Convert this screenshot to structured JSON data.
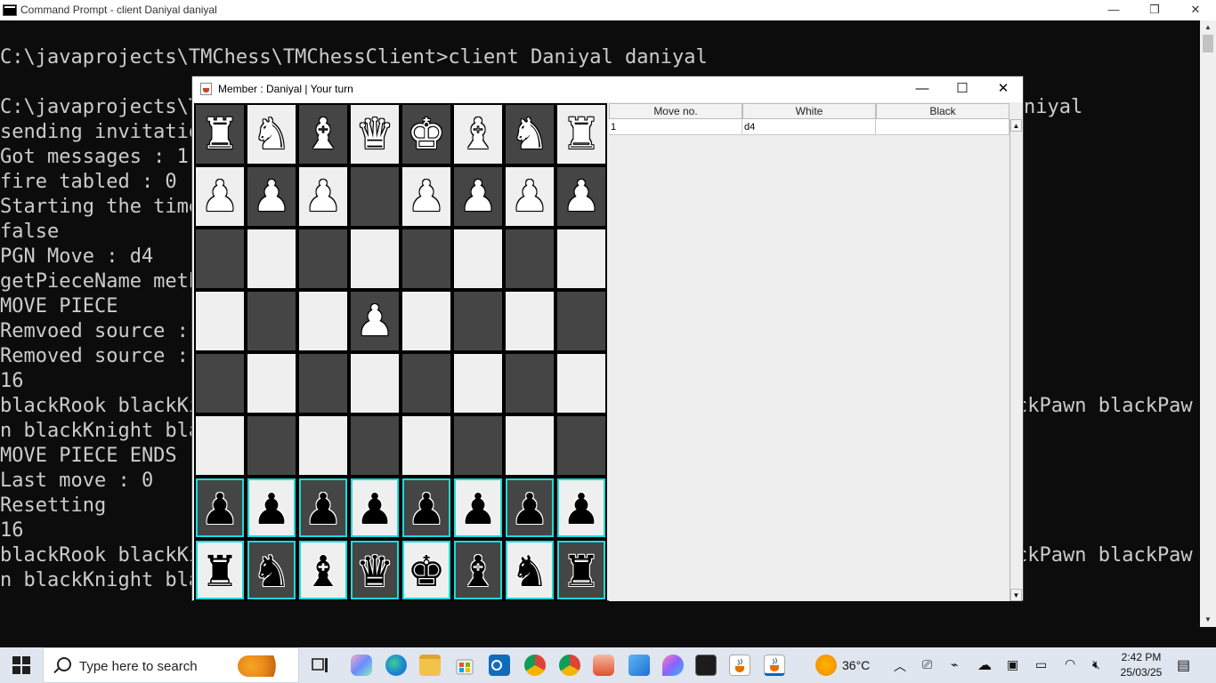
{
  "console": {
    "title": "Command Prompt - client  Daniyal daniyal",
    "controls": {
      "minimize": "—",
      "maximize": "❐",
      "close": "✕"
    },
    "lines": [
      "C:\\javaprojects\\TMChess\\TMChessClient>client Daniyal daniyal",
      "",
      "C:\\javaprojects\\T",
      "sending invitatio",
      "Got messages : 1",
      "fire tabled : 0",
      "Starting the time",
      "false",
      "PGN Move : d4",
      "getPieceName meth",
      "MOVE PIECE",
      "Remvoed source :",
      "Removed source :",
      "16",
      "blackRook blackKi",
      "n blackKnight bla",
      "MOVE PIECE ENDS",
      "Last move : 0",
      "Resetting",
      "16",
      "blackRook blackKi",
      "n blackKnight bla"
    ],
    "right_fragments": {
      "line3": "niyal",
      "line15": "ckPawn blackPaw",
      "line21": "ckPawn blackPaw"
    }
  },
  "chess_window": {
    "title": "Member : Daniyal | Your turn",
    "controls": {
      "minimize": "—",
      "maximize": "☐",
      "close": "✕"
    },
    "board": {
      "highlight_color": "#19dcdc",
      "rows": [
        [
          {
            "p": "♜",
            "c": "white"
          },
          {
            "p": "♞",
            "c": "white"
          },
          {
            "p": "♝",
            "c": "white"
          },
          {
            "p": "♛",
            "c": "white"
          },
          {
            "p": "♚",
            "c": "white"
          },
          {
            "p": "♝",
            "c": "white"
          },
          {
            "p": "♞",
            "c": "white"
          },
          {
            "p": "♜",
            "c": "white"
          }
        ],
        [
          {
            "p": "♟",
            "c": "white"
          },
          {
            "p": "♟",
            "c": "white"
          },
          {
            "p": "♟",
            "c": "white"
          },
          {
            "p": "",
            "c": ""
          },
          {
            "p": "♟",
            "c": "white"
          },
          {
            "p": "♟",
            "c": "white"
          },
          {
            "p": "♟",
            "c": "white"
          },
          {
            "p": "♟",
            "c": "white"
          }
        ],
        [
          {
            "p": "",
            "c": ""
          },
          {
            "p": "",
            "c": ""
          },
          {
            "p": "",
            "c": ""
          },
          {
            "p": "",
            "c": ""
          },
          {
            "p": "",
            "c": ""
          },
          {
            "p": "",
            "c": ""
          },
          {
            "p": "",
            "c": ""
          },
          {
            "p": "",
            "c": ""
          }
        ],
        [
          {
            "p": "",
            "c": ""
          },
          {
            "p": "",
            "c": ""
          },
          {
            "p": "",
            "c": ""
          },
          {
            "p": "♟",
            "c": "white"
          },
          {
            "p": "",
            "c": ""
          },
          {
            "p": "",
            "c": ""
          },
          {
            "p": "",
            "c": ""
          },
          {
            "p": "",
            "c": ""
          }
        ],
        [
          {
            "p": "",
            "c": ""
          },
          {
            "p": "",
            "c": ""
          },
          {
            "p": "",
            "c": ""
          },
          {
            "p": "",
            "c": ""
          },
          {
            "p": "",
            "c": ""
          },
          {
            "p": "",
            "c": ""
          },
          {
            "p": "",
            "c": ""
          },
          {
            "p": "",
            "c": ""
          }
        ],
        [
          {
            "p": "",
            "c": ""
          },
          {
            "p": "",
            "c": ""
          },
          {
            "p": "",
            "c": ""
          },
          {
            "p": "",
            "c": ""
          },
          {
            "p": "",
            "c": ""
          },
          {
            "p": "",
            "c": ""
          },
          {
            "p": "",
            "c": ""
          },
          {
            "p": "",
            "c": ""
          }
        ],
        [
          {
            "p": "♟",
            "c": "black"
          },
          {
            "p": "♟",
            "c": "black"
          },
          {
            "p": "♟",
            "c": "black"
          },
          {
            "p": "♟",
            "c": "black"
          },
          {
            "p": "♟",
            "c": "black"
          },
          {
            "p": "♟",
            "c": "black"
          },
          {
            "p": "♟",
            "c": "black"
          },
          {
            "p": "♟",
            "c": "black"
          }
        ],
        [
          {
            "p": "♜",
            "c": "black"
          },
          {
            "p": "♞",
            "c": "black"
          },
          {
            "p": "♝",
            "c": "black"
          },
          {
            "p": "♛",
            "c": "black"
          },
          {
            "p": "♚",
            "c": "black"
          },
          {
            "p": "♝",
            "c": "black"
          },
          {
            "p": "♞",
            "c": "black"
          },
          {
            "p": "♜",
            "c": "black"
          }
        ]
      ],
      "highlighted_rows": [
        6,
        7
      ]
    },
    "moves_table": {
      "headers": [
        "Move no.",
        "White",
        "Black"
      ],
      "rows": [
        [
          "1",
          "d4",
          ""
        ]
      ]
    }
  },
  "taskbar": {
    "search_placeholder": "Type here to search",
    "weather_temp": "36°C",
    "time": "2:42 PM",
    "date": "25/03/25",
    "apps": [
      "task-view",
      "copilot",
      "edge",
      "file-explorer",
      "store",
      "outlook",
      "chrome-profile",
      "chrome",
      "paint",
      "photos",
      "onedrive-app",
      "terminal",
      "java",
      "java-active"
    ]
  }
}
